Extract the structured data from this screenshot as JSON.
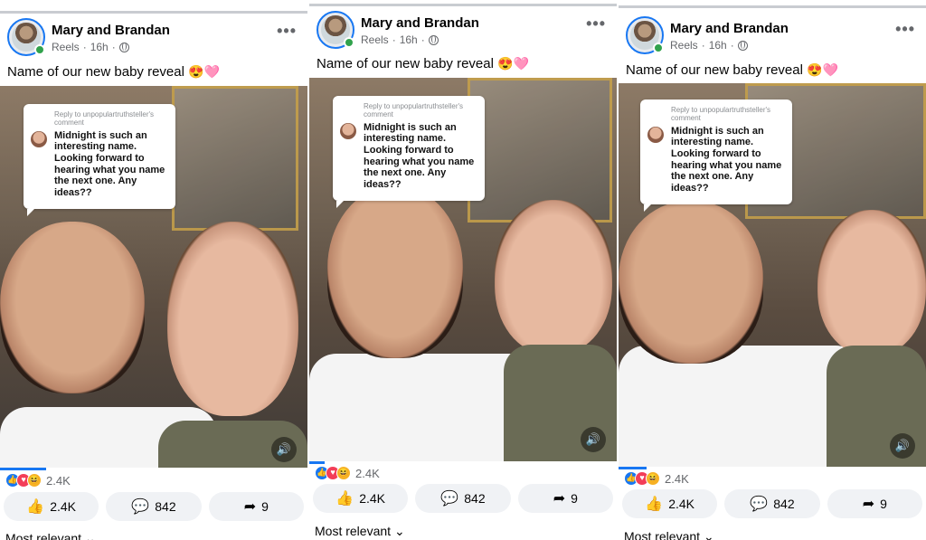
{
  "posts": [
    {
      "author": "Mary and Brandan",
      "meta_source": "Reels",
      "meta_time": "16h",
      "more_label": "•••",
      "caption": "Name of our new baby reveal",
      "caption_emoji": "😍🩷",
      "bubble": {
        "reply_to": "Reply to unpopulartruthsteller's comment",
        "comment": "Midnight is such an interesting name. Looking forward to hearing what you name the next one. Any ideas??"
      },
      "reaction_count": "2.4K",
      "actions": {
        "like": "2.4K",
        "comment": "842",
        "share": "9"
      },
      "sort_label": "Most relevant",
      "progress": 0.15
    },
    {
      "author": "Mary and Brandan",
      "meta_source": "Reels",
      "meta_time": "16h",
      "more_label": "•••",
      "caption": "Name of our new baby reveal",
      "caption_emoji": "😍🩷",
      "bubble": {
        "reply_to": "Reply to unpopulartruthsteller's comment",
        "comment": "Midnight is such an interesting name. Looking forward to hearing what you name the next one. Any ideas??"
      },
      "reaction_count": "2.4K",
      "actions": {
        "like": "2.4K",
        "comment": "842",
        "share": "9"
      },
      "sort_label": "Most relevant",
      "progress": 0.05
    },
    {
      "author": "Mary and Brandan",
      "meta_source": "Reels",
      "meta_time": "16h",
      "more_label": "•••",
      "caption": "Name of our new baby reveal",
      "caption_emoji": "😍🩷",
      "bubble": {
        "reply_to": "Reply to unpopulartruthsteller's comment",
        "comment": "Midnight is such an interesting name. Looking forward to hearing what you name the next one. Any ideas??"
      },
      "reaction_count": "2.4K",
      "actions": {
        "like": "2.4K",
        "comment": "842",
        "share": "9"
      },
      "sort_label": "Most relevant",
      "progress": 0.09
    }
  ],
  "icons": {
    "like": "thumbs-up-icon",
    "comment": "comment-bubble-icon",
    "share": "share-arrow-icon",
    "sound": "speaker-icon",
    "globe": "globe-icon",
    "chevron": "chevron-down-icon"
  },
  "colors": {
    "accent": "#1877f2",
    "online": "#31a24c",
    "love": "#f33e58",
    "haha": "#f7b125",
    "button_bg": "#f0f2f5",
    "meta_text": "#65676b"
  }
}
